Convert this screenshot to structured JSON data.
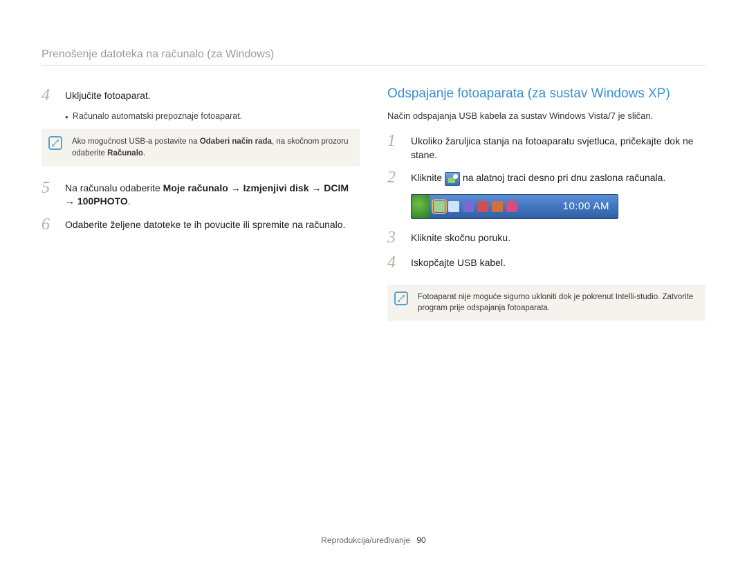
{
  "header": {
    "title": "Prenošenje datoteka na računalo (za Windows)"
  },
  "left": {
    "steps": {
      "s4": {
        "num": "4",
        "text": "Uključite fotoaparat."
      },
      "s4_sub": "Računalo automatski prepoznaje fotoaparat.",
      "note1_a": "Ako mogućnost USB-a postavite na ",
      "note1_b": "Odaberi način rada",
      "note1_c": ", na skočnom prozoru odaberite ",
      "note1_d": "Računalo",
      "note1_e": ".",
      "s5": {
        "num": "5",
        "a": "Na računalu odaberite ",
        "b": "Moje računalo",
        "arr": " → ",
        "c": "Izmjenjivi disk",
        "d": "DCIM",
        "e": "100PHOTO",
        "end": "."
      },
      "s6": {
        "num": "6",
        "text": "Odaberite željene datoteke te ih povucite ili spremite na računalo."
      }
    }
  },
  "right": {
    "heading": "Odspajanje fotoaparata (za sustav Windows XP)",
    "intro": "Način odspajanja USB kabela za sustav Windows Vista/7 je sličan.",
    "steps": {
      "s1": {
        "num": "1",
        "text": "Ukoliko žaruljica stanja na fotoaparatu svjetluca, pričekajte dok ne stane."
      },
      "s2": {
        "num": "2",
        "a": "Kliknite ",
        "b": " na alatnoj traci desno pri dnu zaslona računala."
      },
      "clock": "10:00 AM",
      "s3": {
        "num": "3",
        "text": "Kliknite skočnu poruku."
      },
      "s4": {
        "num": "4",
        "text": "Iskopčajte USB kabel."
      }
    },
    "note2_a": "Fotoaparat nije moguće sigurno ukloniti dok je pokrenut Intelli-studio. Zatvorite program prije odspajanja fotoaparata."
  },
  "footer": {
    "section": "Reprodukcija/uređivanje",
    "page": "90"
  }
}
